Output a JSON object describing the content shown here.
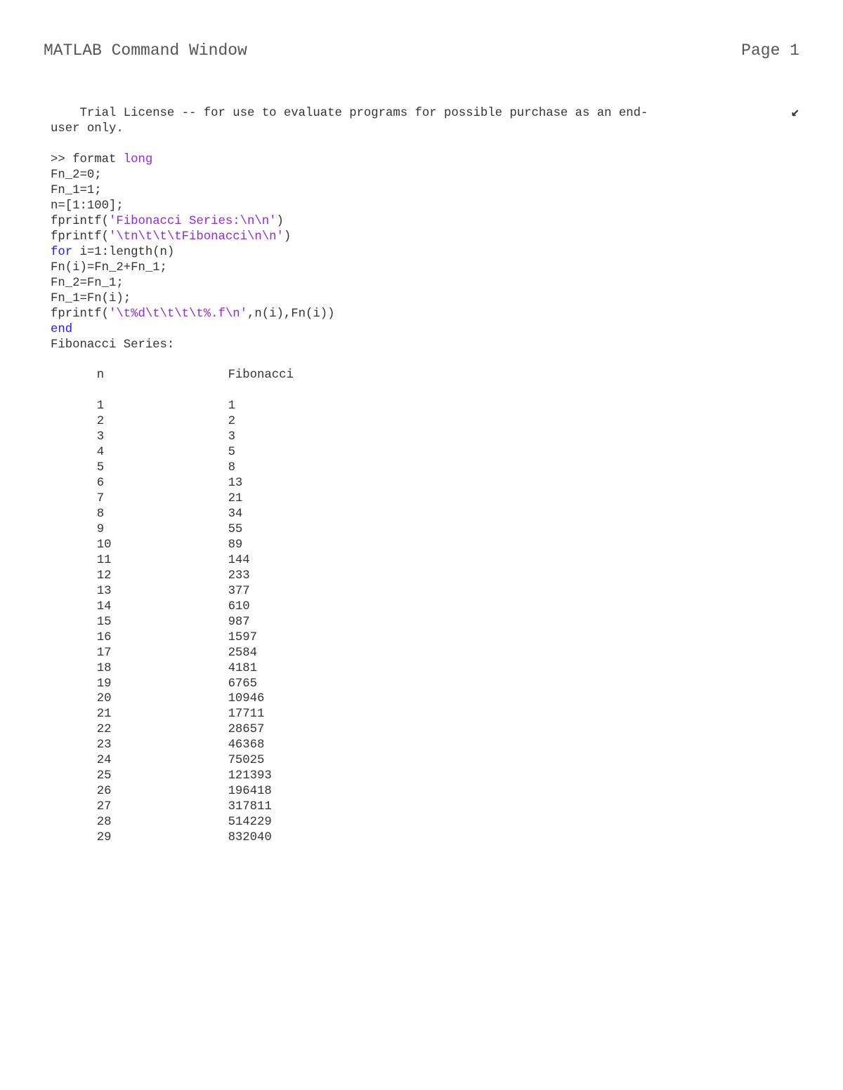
{
  "header": {
    "title": "MATLAB Command Window",
    "page_label": "Page 1"
  },
  "license": {
    "indent": "    ",
    "line1": "Trial License -- for use to evaluate programs for possible purchase as an end-",
    "wrap_glyph": "↙",
    "line2": "user only."
  },
  "code": {
    "prompt": ">> ",
    "lines": {
      "l0_a": "format ",
      "l0_b": "long",
      "l1": "Fn_2=0;",
      "l2": "Fn_1=1;",
      "l3": "n=[1:100];",
      "l4_a": "fprintf(",
      "l4_b": "'Fibonacci Series:\\n\\n'",
      "l4_c": ")",
      "l5_a": "fprintf(",
      "l5_b": "'\\tn\\t\\t\\tFibonacci\\n\\n'",
      "l5_c": ")",
      "l6_a": "for ",
      "l6_b": "i=1:length(n)",
      "l7": "Fn(i)=Fn_2+Fn_1;",
      "l8": "Fn_2=Fn_1;",
      "l9": "Fn_1=Fn(i);",
      "l10_a": "fprintf(",
      "l10_b": "'\\t%d\\t\\t\\t\\t%.f\\n'",
      "l10_c": ",n(i),Fn(i))",
      "l11": "end"
    }
  },
  "output": {
    "title": "Fibonacci Series:",
    "col_n_header": "n",
    "col_f_header": "Fibonacci",
    "rows": [
      {
        "n": "1",
        "f": "1"
      },
      {
        "n": "2",
        "f": "2"
      },
      {
        "n": "3",
        "f": "3"
      },
      {
        "n": "4",
        "f": "5"
      },
      {
        "n": "5",
        "f": "8"
      },
      {
        "n": "6",
        "f": "13"
      },
      {
        "n": "7",
        "f": "21"
      },
      {
        "n": "8",
        "f": "34"
      },
      {
        "n": "9",
        "f": "55"
      },
      {
        "n": "10",
        "f": "89"
      },
      {
        "n": "11",
        "f": "144"
      },
      {
        "n": "12",
        "f": "233"
      },
      {
        "n": "13",
        "f": "377"
      },
      {
        "n": "14",
        "f": "610"
      },
      {
        "n": "15",
        "f": "987"
      },
      {
        "n": "16",
        "f": "1597"
      },
      {
        "n": "17",
        "f": "2584"
      },
      {
        "n": "18",
        "f": "4181"
      },
      {
        "n": "19",
        "f": "6765"
      },
      {
        "n": "20",
        "f": "10946"
      },
      {
        "n": "21",
        "f": "17711"
      },
      {
        "n": "22",
        "f": "28657"
      },
      {
        "n": "23",
        "f": "46368"
      },
      {
        "n": "24",
        "f": "75025"
      },
      {
        "n": "25",
        "f": "121393"
      },
      {
        "n": "26",
        "f": "196418"
      },
      {
        "n": "27",
        "f": "317811"
      },
      {
        "n": "28",
        "f": "514229"
      },
      {
        "n": "29",
        "f": "832040"
      }
    ]
  }
}
